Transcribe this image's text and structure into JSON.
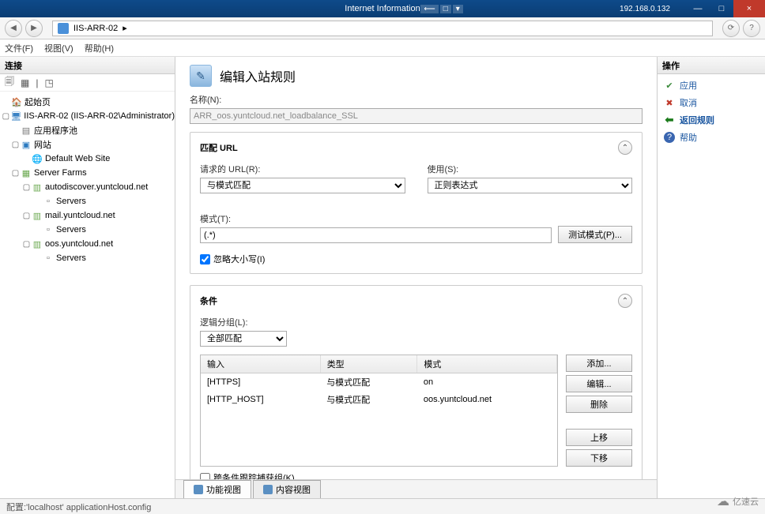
{
  "window": {
    "title": "Internet Information",
    "ip": "192.168.0.132",
    "min": "—",
    "max": "□",
    "close": "×"
  },
  "nav": {
    "back": "◀",
    "fwd": "▶",
    "address_prefix": "IIS-ARR-02",
    "address_suffix": "▸",
    "refresh": "⟳",
    "help_sm": "?"
  },
  "menu": {
    "file": "文件(F)",
    "view": "视图(V)",
    "help": "帮助(H)"
  },
  "left": {
    "header": "连接",
    "toolbar": [
      "🗐",
      "▦",
      "|",
      "◳"
    ],
    "nodes": {
      "start": "起始页",
      "server": "IIS-ARR-02 (IIS-ARR-02\\Administrator)",
      "apppool": "应用程序池",
      "sites": "网站",
      "default_site": "Default Web Site",
      "farms": "Server Farms",
      "farm1": "autodiscover.yuntcloud.net",
      "farm1_srv": "Servers",
      "farm2": "mail.yuntcloud.net",
      "farm2_srv": "Servers",
      "farm3": "oos.yuntcloud.net",
      "farm3_srv": "Servers"
    }
  },
  "main": {
    "title": "编辑入站规则",
    "name_label": "名称(N):",
    "name_value": "ARR_oos.yuntcloud.net_loadbalance_SSL",
    "match_group": "匹配 URL",
    "requested_url_label": "请求的 URL(R):",
    "requested_url_value": "与模式匹配",
    "using_label": "使用(S):",
    "using_value": "正则表达式",
    "pattern_label": "模式(T):",
    "pattern_value": "(.*)",
    "test_btn": "测试模式(P)...",
    "ignore_case": "忽略大小写(I)",
    "cond_group": "条件",
    "logic_label": "逻辑分组(L):",
    "logic_value": "全部匹配",
    "cond_headers": {
      "input": "输入",
      "type": "类型",
      "pattern": "模式"
    },
    "cond_rows": [
      {
        "input": "[HTTPS]",
        "type": "与模式匹配",
        "pattern": "on"
      },
      {
        "input": "[HTTP_HOST]",
        "type": "与模式匹配",
        "pattern": "oos.yuntcloud.net"
      }
    ],
    "btn_add": "添加...",
    "btn_edit": "编辑...",
    "btn_del": "删除",
    "btn_up": "上移",
    "btn_down": "下移",
    "track_capture": "跨条件跟踪捕获组(K)",
    "collapse": "⌃"
  },
  "tabs": {
    "features": "功能视图",
    "content": "内容视图"
  },
  "right": {
    "header": "操作",
    "apply": "应用",
    "cancel": "取消",
    "back": "返回规则",
    "help": "帮助"
  },
  "status": "配置:'localhost' applicationHost.config",
  "watermark": "亿速云"
}
